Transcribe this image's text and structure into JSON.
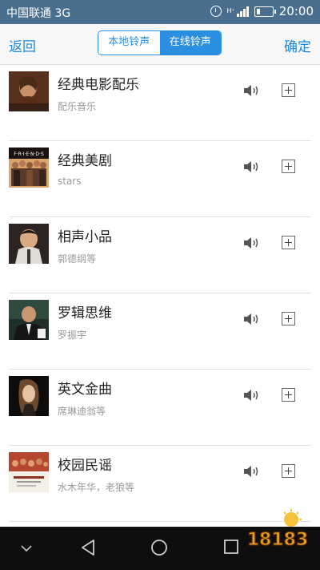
{
  "status_bar": {
    "carrier": "中国联通 3G",
    "time": "20:00"
  },
  "header": {
    "back_label": "返回",
    "tab_local": "本地铃声",
    "tab_online": "在线铃声",
    "confirm_label": "确定"
  },
  "items": [
    {
      "title": "经典电影配乐",
      "subtitle": "配乐音乐"
    },
    {
      "title": "经典美剧",
      "subtitle": "stars"
    },
    {
      "title": "相声小品",
      "subtitle": "郭德纲等"
    },
    {
      "title": "罗辑思维",
      "subtitle": "罗振宇"
    },
    {
      "title": "英文金曲",
      "subtitle": "席琳迪翁等"
    },
    {
      "title": "校园民谣",
      "subtitle": "水木年华，老狼等"
    }
  ],
  "watermark": {
    "text": "18183"
  },
  "colors": {
    "accent": "#2a8fe0",
    "status_bar": "#4a6f8e",
    "nav_bar": "#0e0e0e"
  }
}
